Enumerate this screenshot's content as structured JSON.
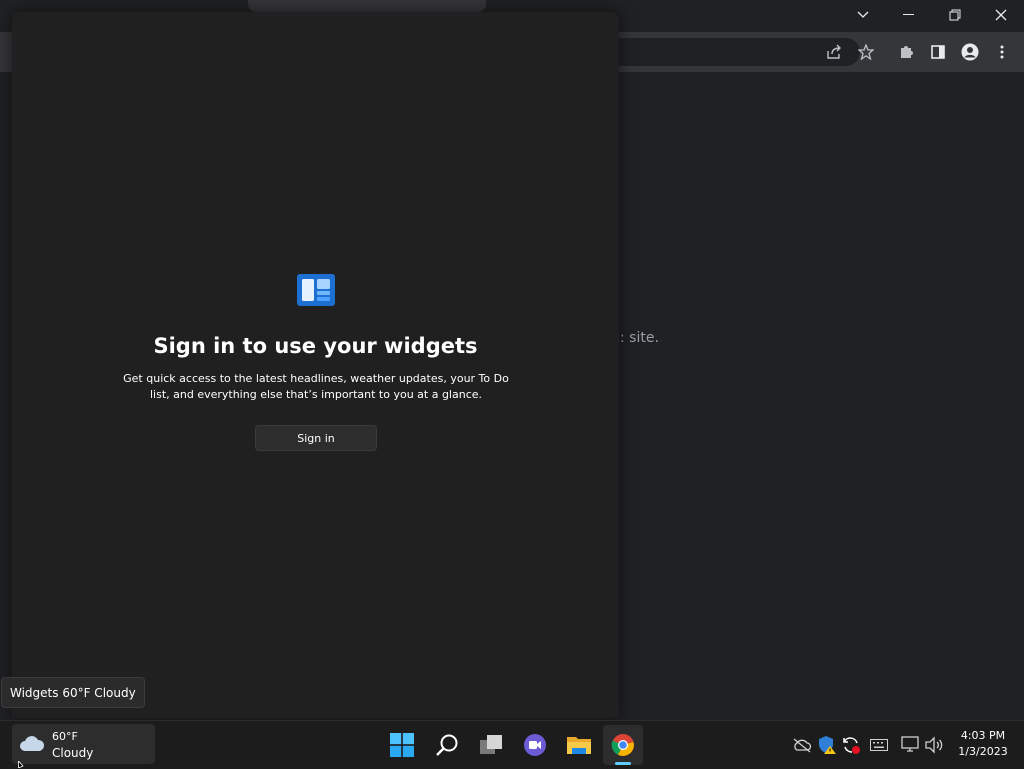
{
  "browser": {
    "page_partial_text": ": site."
  },
  "widgets": {
    "title": "Sign in to use your widgets",
    "description": "Get quick access to the latest headlines, weather updates, your To Do list, and everything else that’s important to you at a glance.",
    "signin_label": "Sign in"
  },
  "tooltip": {
    "text": "Widgets 60°F Cloudy"
  },
  "taskbar": {
    "weather_temp": "60°F",
    "weather_condition": "Cloudy",
    "time": "4:03 PM",
    "date": "1/3/2023"
  },
  "colors": {
    "accent": "#60cdff",
    "panel_bg": "#202020",
    "taskbar_bg": "#1c1c1c"
  }
}
